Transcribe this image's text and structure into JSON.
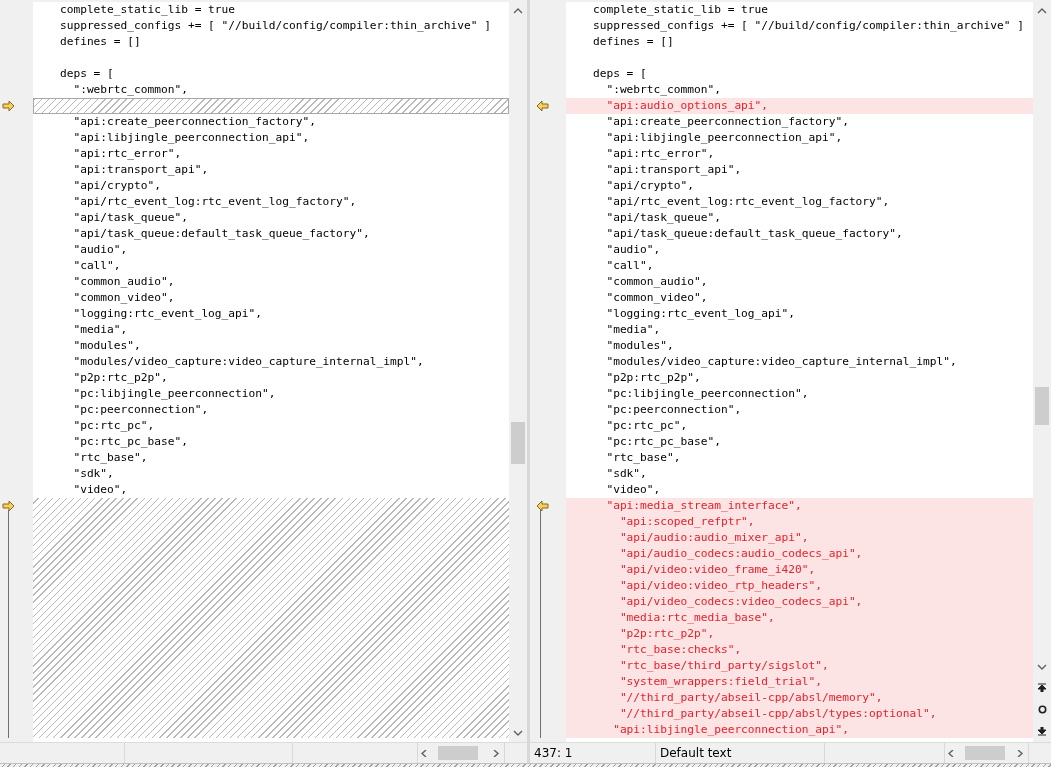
{
  "panes": [
    {
      "lines": [
        {
          "kind": "normal",
          "text": "    complete_static_lib = true"
        },
        {
          "kind": "normal",
          "text": "    suppressed_configs += [ \"//build/config/compiler:thin_archive\" ]"
        },
        {
          "kind": "normal",
          "text": "    defines = []"
        },
        {
          "kind": "normal"
        },
        {
          "kind": "normal",
          "text": "    deps = ["
        },
        {
          "kind": "normal",
          "text": "      \":webrtc_common\","
        },
        {
          "kind": "missing",
          "marker": true
        },
        {
          "kind": "normal",
          "text": "      \"api:create_peerconnection_factory\","
        },
        {
          "kind": "normal",
          "text": "      \"api:libjingle_peerconnection_api\","
        },
        {
          "kind": "normal",
          "text": "      \"api:rtc_error\","
        },
        {
          "kind": "normal",
          "text": "      \"api:transport_api\","
        },
        {
          "kind": "normal",
          "text": "      \"api/crypto\","
        },
        {
          "kind": "normal",
          "text": "      \"api/rtc_event_log:rtc_event_log_factory\","
        },
        {
          "kind": "normal",
          "text": "      \"api/task_queue\","
        },
        {
          "kind": "normal",
          "text": "      \"api/task_queue:default_task_queue_factory\","
        },
        {
          "kind": "normal",
          "text": "      \"audio\","
        },
        {
          "kind": "normal",
          "text": "      \"call\","
        },
        {
          "kind": "normal",
          "text": "      \"common_audio\","
        },
        {
          "kind": "normal",
          "text": "      \"common_video\","
        },
        {
          "kind": "normal",
          "text": "      \"logging:rtc_event_log_api\","
        },
        {
          "kind": "normal",
          "text": "      \"media\","
        },
        {
          "kind": "normal",
          "text": "      \"modules\","
        },
        {
          "kind": "normal",
          "text": "      \"modules/video_capture:video_capture_internal_impl\","
        },
        {
          "kind": "normal",
          "text": "      \"p2p:rtc_p2p\","
        },
        {
          "kind": "normal",
          "text": "      \"pc:libjingle_peerconnection\","
        },
        {
          "kind": "normal",
          "text": "      \"pc:peerconnection\","
        },
        {
          "kind": "normal",
          "text": "      \"pc:rtc_pc\","
        },
        {
          "kind": "normal",
          "text": "      \"pc:rtc_pc_base\","
        },
        {
          "kind": "normal",
          "text": "      \"rtc_base\","
        },
        {
          "kind": "normal",
          "text": "      \"sdk\","
        },
        {
          "kind": "normal",
          "text": "      \"video\","
        },
        {
          "kind": "missing",
          "marker": true
        },
        {
          "kind": "missing"
        },
        {
          "kind": "missing"
        },
        {
          "kind": "missing"
        },
        {
          "kind": "missing"
        },
        {
          "kind": "missing"
        },
        {
          "kind": "missing"
        },
        {
          "kind": "missing"
        },
        {
          "kind": "missing"
        },
        {
          "kind": "missing"
        },
        {
          "kind": "missing"
        },
        {
          "kind": "missing"
        },
        {
          "kind": "missing"
        },
        {
          "kind": "missing"
        },
        {
          "kind": "missing"
        }
      ]
    },
    {
      "lines": [
        {
          "kind": "normal",
          "text": "    complete_static_lib = true"
        },
        {
          "kind": "normal",
          "text": "    suppressed_configs += [ \"//build/config/compiler:thin_archive\" ]"
        },
        {
          "kind": "normal",
          "text": "    defines = []"
        },
        {
          "kind": "normal"
        },
        {
          "kind": "normal",
          "text": "    deps = ["
        },
        {
          "kind": "normal",
          "text": "      \":webrtc_common\","
        },
        {
          "kind": "added",
          "marker": true,
          "text": "      \"api:audio_options_api\","
        },
        {
          "kind": "normal",
          "text": "      \"api:create_peerconnection_factory\","
        },
        {
          "kind": "normal",
          "text": "      \"api:libjingle_peerconnection_api\","
        },
        {
          "kind": "normal",
          "text": "      \"api:rtc_error\","
        },
        {
          "kind": "normal",
          "text": "      \"api:transport_api\","
        },
        {
          "kind": "normal",
          "text": "      \"api/crypto\","
        },
        {
          "kind": "normal",
          "text": "      \"api/rtc_event_log:rtc_event_log_factory\","
        },
        {
          "kind": "normal",
          "text": "      \"api/task_queue\","
        },
        {
          "kind": "normal",
          "text": "      \"api/task_queue:default_task_queue_factory\","
        },
        {
          "kind": "normal",
          "text": "      \"audio\","
        },
        {
          "kind": "normal",
          "text": "      \"call\","
        },
        {
          "kind": "normal",
          "text": "      \"common_audio\","
        },
        {
          "kind": "normal",
          "text": "      \"common_video\","
        },
        {
          "kind": "normal",
          "text": "      \"logging:rtc_event_log_api\","
        },
        {
          "kind": "normal",
          "text": "      \"media\","
        },
        {
          "kind": "normal",
          "text": "      \"modules\","
        },
        {
          "kind": "normal",
          "text": "      \"modules/video_capture:video_capture_internal_impl\","
        },
        {
          "kind": "normal",
          "text": "      \"p2p:rtc_p2p\","
        },
        {
          "kind": "normal",
          "text": "      \"pc:libjingle_peerconnection\","
        },
        {
          "kind": "normal",
          "text": "      \"pc:peerconnection\","
        },
        {
          "kind": "normal",
          "text": "      \"pc:rtc_pc\","
        },
        {
          "kind": "normal",
          "text": "      \"pc:rtc_pc_base\","
        },
        {
          "kind": "normal",
          "text": "      \"rtc_base\","
        },
        {
          "kind": "normal",
          "text": "      \"sdk\","
        },
        {
          "kind": "normal",
          "text": "      \"video\","
        },
        {
          "kind": "added",
          "marker": true,
          "text": "      \"api:media_stream_interface\","
        },
        {
          "kind": "added",
          "text": "        \"api:scoped_refptr\","
        },
        {
          "kind": "added",
          "text": "        \"api/audio:audio_mixer_api\","
        },
        {
          "kind": "added",
          "text": "        \"api/audio_codecs:audio_codecs_api\","
        },
        {
          "kind": "added",
          "text": "        \"api/video:video_frame_i420\","
        },
        {
          "kind": "added",
          "text": "        \"api/video:video_rtp_headers\","
        },
        {
          "kind": "added",
          "text": "        \"api/video_codecs:video_codecs_api\","
        },
        {
          "kind": "added",
          "text": "        \"media:rtc_media_base\","
        },
        {
          "kind": "added",
          "text": "        \"p2p:rtc_p2p\","
        },
        {
          "kind": "added",
          "text": "        \"rtc_base:checks\","
        },
        {
          "kind": "added",
          "text": "        \"rtc_base/third_party/sigslot\","
        },
        {
          "kind": "added",
          "text": "        \"system_wrappers:field_trial\","
        },
        {
          "kind": "added",
          "text": "        \"//third_party/abseil-cpp/absl/memory\","
        },
        {
          "kind": "added",
          "text": "        \"//third_party/abseil-cpp/absl/types:optional\","
        },
        {
          "kind": "added",
          "text": "       \"api:libjingle_peerconnection_api\","
        }
      ],
      "status": {
        "position": "437: 1",
        "mode": "Default text"
      }
    }
  ]
}
